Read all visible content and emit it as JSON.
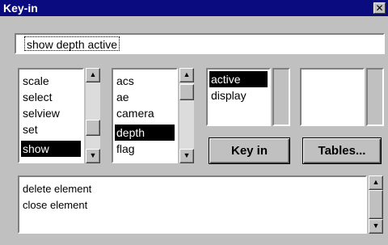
{
  "window": {
    "title": "Key-in",
    "close_glyph": "✕"
  },
  "command": {
    "value": "show depth active"
  },
  "list1": {
    "items": [
      "scale",
      "select",
      "selview",
      "set",
      "show"
    ],
    "selected": 4
  },
  "list2": {
    "items": [
      "acs",
      "ae",
      "camera",
      "depth",
      "flag"
    ],
    "selected": 3
  },
  "list3": {
    "items": [
      "active",
      "display"
    ],
    "selected": 0
  },
  "buttons": {
    "keyin_label": "Key in",
    "tables_label": "Tables..."
  },
  "output": {
    "lines": [
      "delete element",
      "close element"
    ]
  },
  "icons": {
    "up": "▲",
    "down": "▼"
  }
}
